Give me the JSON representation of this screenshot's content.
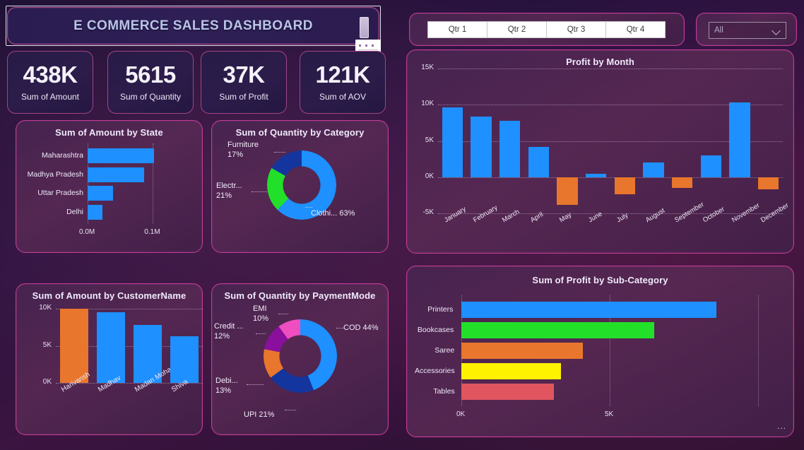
{
  "header": {
    "title": "E COMMERCE SALES DASHBOARD",
    "notepad_icon": "notepad-icon",
    "resize_handle": "resize-handle"
  },
  "kpis": [
    {
      "value": "438K",
      "label": "Sum of Amount"
    },
    {
      "value": "5615",
      "label": "Sum of Quantity"
    },
    {
      "value": "37K",
      "label": "Sum of Profit"
    },
    {
      "value": "121K",
      "label": "Sum of AOV"
    }
  ],
  "slicer": {
    "quarters": [
      "Qtr 1",
      "Qtr 2",
      "Qtr 3",
      "Qtr 4"
    ],
    "dropdown_value": "All",
    "dropdown_icon": "chevron-down-icon"
  },
  "panels": {
    "profit_by_month": "Profit by Month",
    "amount_by_state": "Sum of Amount by State",
    "quantity_by_category": "Sum of Quantity by Category",
    "amount_by_customer": "Sum of Amount by CustomerName",
    "quantity_by_paymentmode": "Sum of Quantity by PaymentMode",
    "profit_by_subcategory": "Sum of Profit by Sub-Category",
    "subcategory_more": "..."
  },
  "colors": {
    "blue": "#1e90ff",
    "orange": "#e8762c",
    "green": "#22e02a",
    "dark_blue": "#15359e",
    "yellow": "#fff200",
    "red": "#e0555f",
    "purple": "#8a0f9c",
    "pink": "#ef4ec0",
    "card_border": "#c23a96"
  },
  "chart_data": [
    {
      "id": "profit-by-month",
      "type": "bar",
      "title": "Profit by Month",
      "xlabel": "",
      "ylabel": "",
      "ylim": [
        -5000,
        15000
      ],
      "yticks": [
        -5000,
        0,
        5000,
        10000,
        15000
      ],
      "ytick_labels": [
        "-5K",
        "0K",
        "5K",
        "10K",
        "15K"
      ],
      "grid": true,
      "categories": [
        "January",
        "February",
        "March",
        "April",
        "May",
        "June",
        "July",
        "August",
        "September",
        "October",
        "November",
        "December"
      ],
      "values": [
        9600,
        8400,
        7800,
        4200,
        -3800,
        500,
        -2400,
        2000,
        -1500,
        3000,
        10300,
        -1700
      ],
      "positive_color": "#1e90ff",
      "negative_color": "#e8762c"
    },
    {
      "id": "amount-by-state",
      "type": "bar",
      "orientation": "horizontal",
      "title": "Sum of Amount by State",
      "xlim": [
        0,
        0.13
      ],
      "xticks": [
        0,
        0.1
      ],
      "xtick_labels": [
        "0.0M",
        "0.1M"
      ],
      "grid": true,
      "categories": [
        "Maharashtra",
        "Madhya Pradesh",
        "Uttar Pradesh",
        "Delhi"
      ],
      "values": [
        0.102,
        0.087,
        0.039,
        0.023
      ],
      "color": "#1e90ff"
    },
    {
      "id": "quantity-by-category",
      "type": "pie",
      "title": "Sum of Quantity by Category",
      "labels": [
        "Clothi...",
        "Electr...",
        "Furniture"
      ],
      "percent_labels": [
        "Clothi... 63%",
        "Electr...\n21%",
        "Furniture\n17%"
      ],
      "values": [
        63,
        21,
        17
      ],
      "colors": [
        "#1e90ff",
        "#22e02a",
        "#15359e"
      ],
      "donut": true
    },
    {
      "id": "amount-by-customer",
      "type": "bar",
      "title": "Sum of Amount by CustomerName",
      "ylim": [
        0,
        10000
      ],
      "yticks": [
        0,
        5000,
        10000
      ],
      "ytick_labels": [
        "0K",
        "5K",
        "10K"
      ],
      "grid": true,
      "categories": [
        "Harivansh",
        "Madhav",
        "Madan Mohan",
        "Shiva"
      ],
      "values": [
        10000,
        9500,
        7800,
        6300
      ],
      "bar_colors": [
        "#e8762c",
        "#1e90ff",
        "#1e90ff",
        "#1e90ff"
      ]
    },
    {
      "id": "quantity-by-paymentmode",
      "type": "pie",
      "title": "Sum of Quantity by PaymentMode",
      "labels": [
        "COD",
        "UPI",
        "Debi...",
        "Credit ...",
        "EMI"
      ],
      "percent_labels": [
        "COD 44%",
        "UPI 21%",
        "Debi...\n13%",
        "Credit ...\n12%",
        "EMI\n10%"
      ],
      "values": [
        44,
        21,
        13,
        12,
        10
      ],
      "colors": [
        "#1e90ff",
        "#15359e",
        "#e8762c",
        "#8a0f9c",
        "#ef4ec0"
      ],
      "donut": true
    },
    {
      "id": "profit-by-subcategory",
      "type": "bar",
      "orientation": "horizontal",
      "title": "Sum of Profit by Sub-Category",
      "xlim": [
        0,
        10000
      ],
      "xticks": [
        0,
        5000
      ],
      "xtick_labels": [
        "0K",
        "5K"
      ],
      "grid": true,
      "categories": [
        "Printers",
        "Bookcases",
        "Saree",
        "Accessories",
        "Tables"
      ],
      "values": [
        8600,
        6500,
        4100,
        3350,
        3130
      ],
      "bar_colors": [
        "#1e90ff",
        "#22e02a",
        "#e8762c",
        "#fff200",
        "#e0555f"
      ]
    }
  ]
}
